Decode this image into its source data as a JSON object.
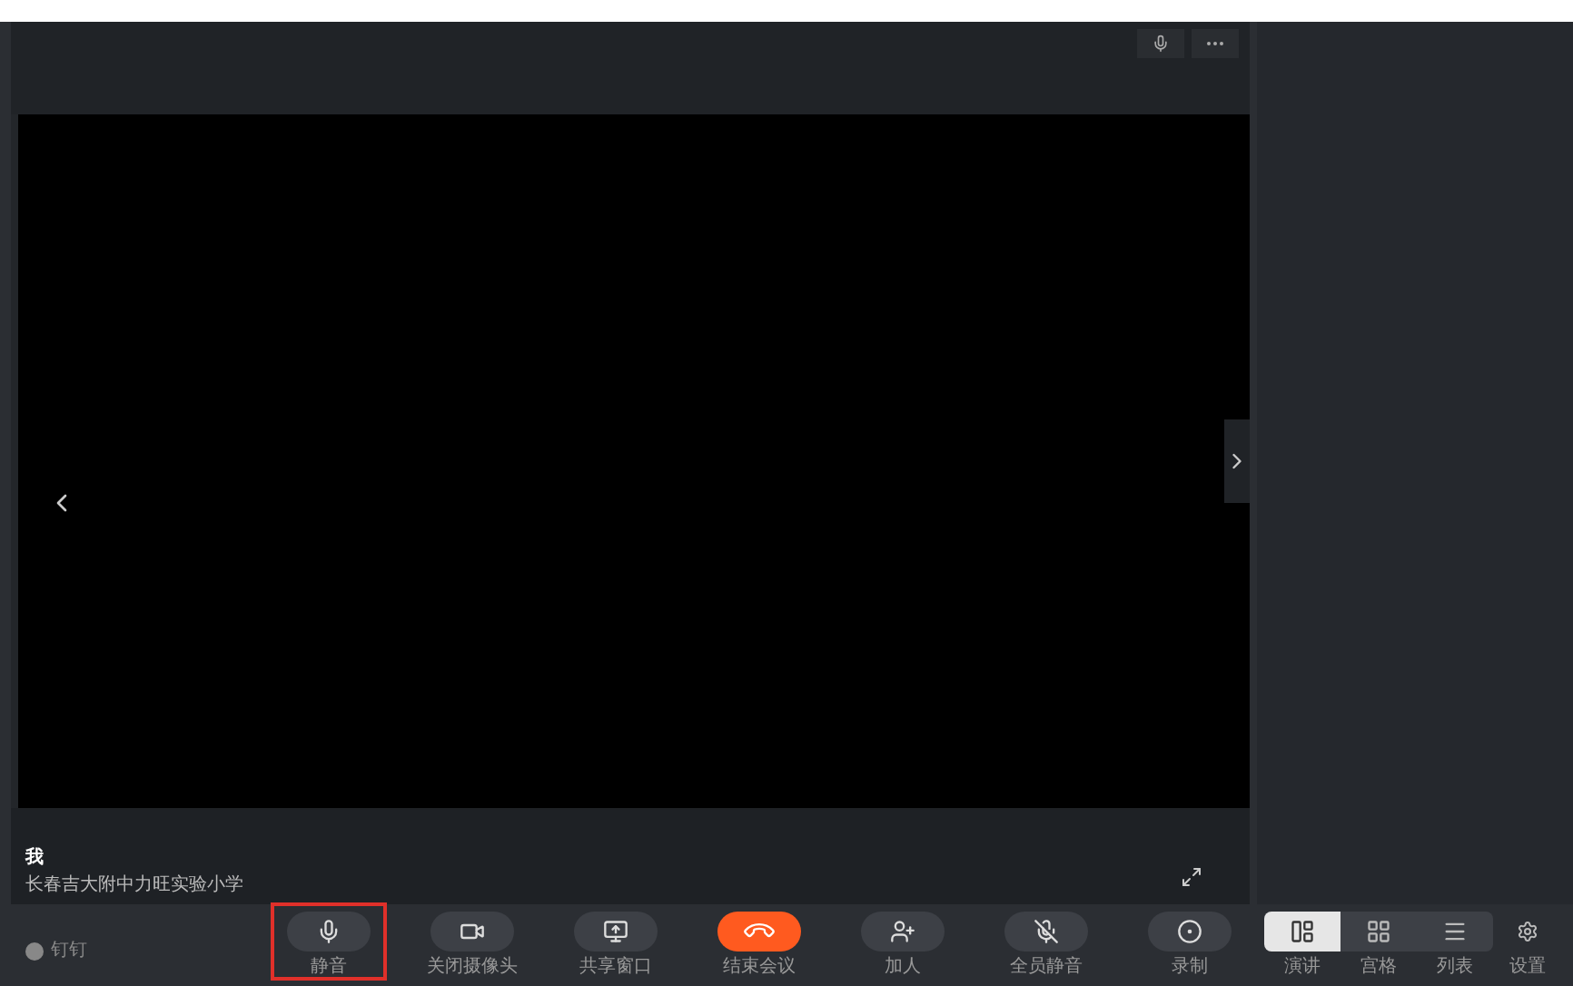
{
  "video": {
    "name": "我",
    "subtitle": "长春吉大附中力旺实验小学"
  },
  "brand": {
    "label": "钉钉"
  },
  "controls": [
    {
      "kind": "mic",
      "label": "静音",
      "selected": true
    },
    {
      "kind": "camera",
      "label": "关闭摄像头",
      "selected": false
    },
    {
      "kind": "share",
      "label": "共享窗口",
      "selected": false
    },
    {
      "kind": "end",
      "label": "结束会议",
      "selected": false
    },
    {
      "kind": "add",
      "label": "加人",
      "selected": false
    },
    {
      "kind": "muteall",
      "label": "全员静音",
      "selected": false
    },
    {
      "kind": "record",
      "label": "录制",
      "selected": false
    }
  ],
  "views": [
    {
      "kind": "speaker",
      "label": "演讲",
      "selected": true
    },
    {
      "kind": "grid",
      "label": "宫格",
      "selected": false
    },
    {
      "kind": "list",
      "label": "列表",
      "selected": false
    }
  ],
  "settings": {
    "label": "设置"
  }
}
